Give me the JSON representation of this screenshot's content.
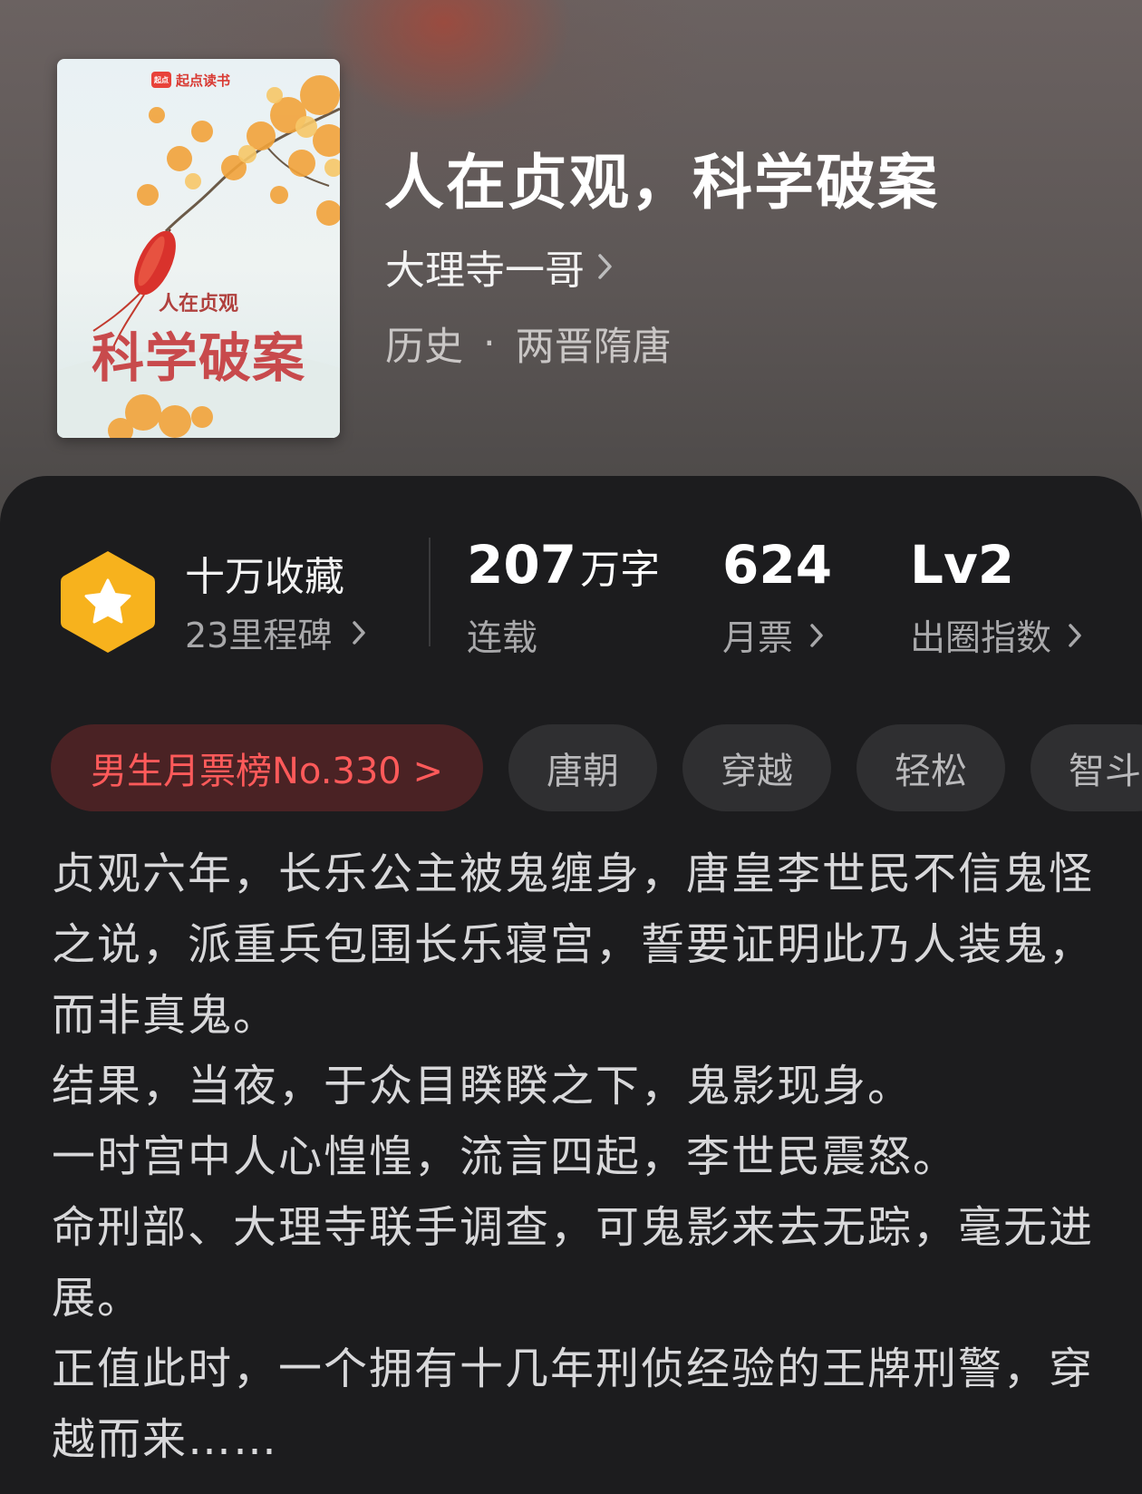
{
  "book": {
    "cover": {
      "brand": "起点读书",
      "brand_badge": "起点",
      "title_small": "人在贞观",
      "title_big": "科学破案"
    },
    "title": "人在贞观，科学破案",
    "author": "大理寺一哥",
    "genre": "历史",
    "genre_sep": "·",
    "subgenre": "两晋隋唐"
  },
  "stats": {
    "milestone": {
      "icon": "star-hexagon-icon",
      "title": "十万收藏",
      "subtitle": "23里程碑"
    },
    "words": {
      "value": "207",
      "unit": "万字",
      "label": "连载"
    },
    "monthly_tickets": {
      "value": "624",
      "label": "月票"
    },
    "popularity": {
      "value": "Lv2",
      "label": "出圈指数"
    }
  },
  "tags": [
    {
      "label": "男生月票榜No.330 >"
    },
    {
      "label": "唐朝"
    },
    {
      "label": "穿越"
    },
    {
      "label": "轻松"
    },
    {
      "label": "智斗"
    }
  ],
  "synopsis": [
    "贞观六年，长乐公主被鬼缠身，唐皇李世民不信鬼怪之说，派重兵包围长乐寝宫，誓要证明此乃人装鬼，而非真鬼。",
    "结果，当夜，于众目睽睽之下，鬼影现身。",
    "一时宫中人心惶惶，流言四起，李世民震怒。",
    "命刑部、大理寺联手调查，可鬼影来去无踪，毫无进展。",
    "正值此时，一个拥有十几年刑侦经验的王牌刑警，穿越而来……"
  ],
  "colors": {
    "panel_bg": "#1c1c1e",
    "accent_red": "#ff5a5a",
    "milestone_gold": "#f7b21d",
    "tag_bg": "#2f2f31"
  }
}
